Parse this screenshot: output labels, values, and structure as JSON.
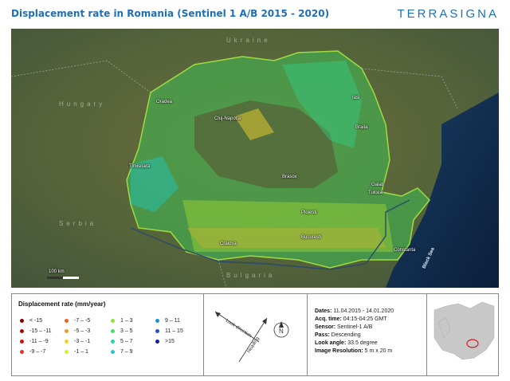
{
  "header": {
    "title": "Displacement rate in Romania (Sentinel 1 A/B 2015 - 2020)",
    "logo": "TERRASIGNA"
  },
  "map": {
    "countries": [
      "Ukraine",
      "Hungary",
      "Serbia",
      "Bulgaria"
    ],
    "cities": [
      "Oradea",
      "Cluj-Napoca",
      "Iasi",
      "Braila",
      "Timisoara",
      "Brasov",
      "Galati",
      "Tulcea",
      "Ploiesti",
      "Craiova",
      "Bucuresti",
      "Constanta"
    ],
    "sea": "Black Sea",
    "scale_label": "100 km"
  },
  "legend": {
    "title": "Displacement rate (mm/year)",
    "items": [
      {
        "label": "< -15",
        "color": "#8b0000"
      },
      {
        "label": "-15 – -11",
        "color": "#b00000"
      },
      {
        "label": "-11 – -9",
        "color": "#d01010"
      },
      {
        "label": "-9 – -7",
        "color": "#e83020"
      },
      {
        "label": "-7 – -5",
        "color": "#f06020"
      },
      {
        "label": "-5 – -3",
        "color": "#f49a20"
      },
      {
        "label": "-3 – -1",
        "color": "#f6d020"
      },
      {
        "label": "-1 – 1",
        "color": "#d8f020"
      },
      {
        "label": "1 – 3",
        "color": "#8ce830"
      },
      {
        "label": "3 – 5",
        "color": "#40e060"
      },
      {
        "label": "5 – 7",
        "color": "#20d8a0"
      },
      {
        "label": "7 – 9",
        "color": "#20c8d0"
      },
      {
        "label": "9 – 11",
        "color": "#2090e0"
      },
      {
        "label": "11 – 15",
        "color": "#2050d0"
      },
      {
        "label": ">15",
        "color": "#1020a0"
      }
    ]
  },
  "geometry": {
    "look_direction": "Look direction",
    "heading": "Heading",
    "north": "N"
  },
  "info": {
    "dates_label": "Dates:",
    "dates_value": "11.04.2015 - 14.01.2020",
    "acq_label": "Acq. time:",
    "acq_value": "04:15-04:25 GMT",
    "sensor_label": "Sensor:",
    "sensor_value": "Sentinel-1 A/B",
    "pass_label": "Pass:",
    "pass_value": "Descending",
    "look_label": "Look angle:",
    "look_value": "33.5 degree",
    "res_label": "Image Resolution:",
    "res_value": "5 m x 20 m"
  },
  "colors": {
    "brand": "#1f6fb5",
    "sea": "#0e2a4a",
    "terrain": "#5b6b3f"
  }
}
